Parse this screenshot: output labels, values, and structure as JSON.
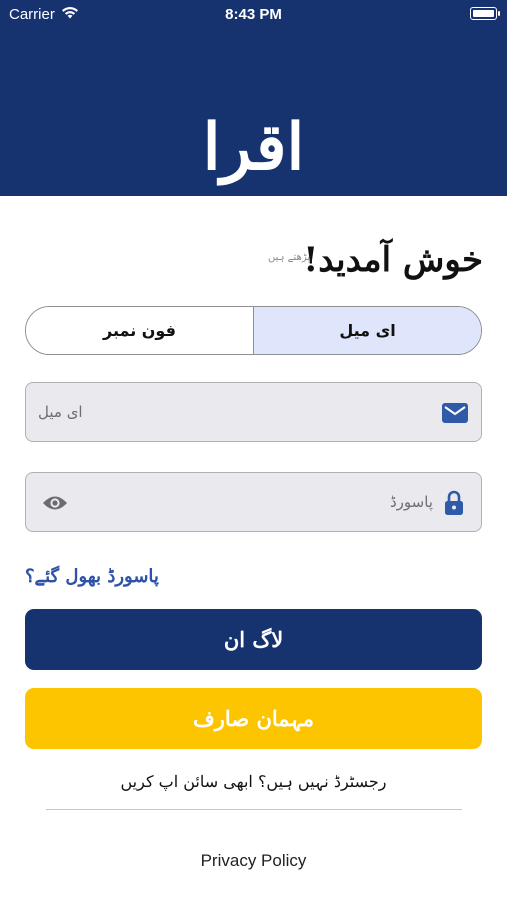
{
  "status_bar": {
    "carrier": "Carrier",
    "time": "8:43 PM"
  },
  "header": {
    "logo_text": "اقرا"
  },
  "welcome": {
    "title": "خوش آمدید!",
    "subtitle": "پڑھتے ہیں"
  },
  "segment": {
    "options": [
      "فون نمبر",
      "ای میل"
    ],
    "selected": "ای میل"
  },
  "email_field": {
    "placeholder": "ای میل",
    "icon": "mail-icon"
  },
  "password_field": {
    "placeholder": "پاسورڈ",
    "lock_icon": "lock-icon",
    "toggle_icon": "eye-icon"
  },
  "forgot_password": "پاسورڈ بھول گئے؟",
  "login_button": "لاگ ان",
  "guest_button": "مہمان صارف",
  "signup_text": "رجسٹرڈ نہیں ہیں؟ ابھی سائن اپ کریں",
  "privacy_link": "Privacy Policy",
  "colors": {
    "primary": "#17336f",
    "accent": "#fdc400",
    "segment_active": "#dfe5fa",
    "link": "#2d53a8"
  }
}
